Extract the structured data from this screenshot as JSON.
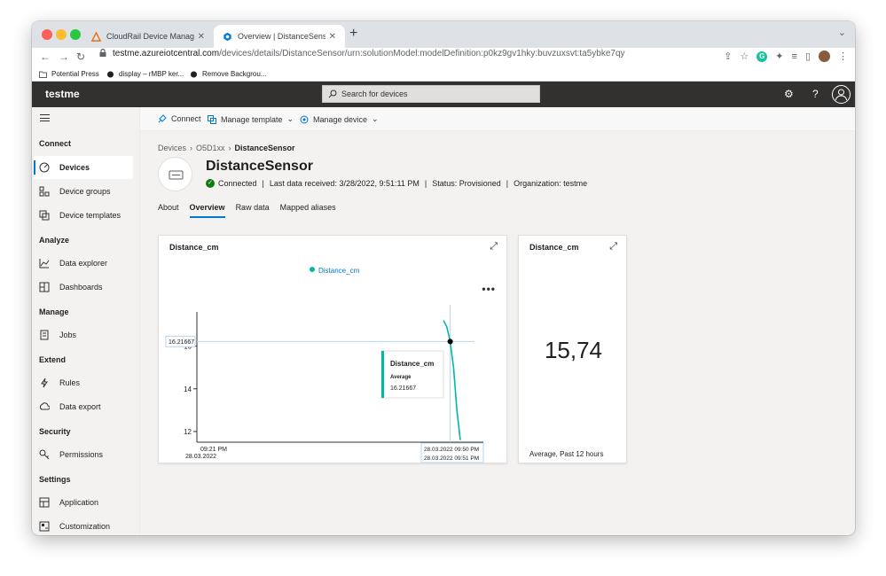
{
  "browser": {
    "tabs": [
      {
        "title": "CloudRail Device Management",
        "close": "✕"
      },
      {
        "title": "Overview | DistanceSensor, te",
        "close": "✕"
      }
    ],
    "new_tab": "+",
    "url_host": "testme.azureiotcentral.com",
    "url_path": "/devices/details/DistanceSensor/urn:solutionModel:modelDefinition:p0kz9gv1hky:buvzuxsvt:ta5ybke7qy",
    "bookmarks": [
      "Potential Press",
      "display – rMBP ker...",
      "Remove Backgrou..."
    ],
    "extension_letter": "G"
  },
  "app": {
    "name": "testme",
    "search_placeholder": "Search for devices"
  },
  "sidebar": {
    "sections": [
      {
        "title": "Connect",
        "items": [
          {
            "label": "Devices",
            "icon": "devices-icon",
            "active": true
          },
          {
            "label": "Device groups",
            "icon": "device-groups-icon"
          },
          {
            "label": "Device templates",
            "icon": "device-templates-icon"
          }
        ]
      },
      {
        "title": "Analyze",
        "items": [
          {
            "label": "Data explorer",
            "icon": "data-explorer-icon"
          },
          {
            "label": "Dashboards",
            "icon": "dashboards-icon"
          }
        ]
      },
      {
        "title": "Manage",
        "items": [
          {
            "label": "Jobs",
            "icon": "jobs-icon"
          }
        ]
      },
      {
        "title": "Extend",
        "items": [
          {
            "label": "Rules",
            "icon": "rules-icon"
          },
          {
            "label": "Data export",
            "icon": "data-export-icon"
          }
        ]
      },
      {
        "title": "Security",
        "items": [
          {
            "label": "Permissions",
            "icon": "permissions-icon"
          }
        ]
      },
      {
        "title": "Settings",
        "items": [
          {
            "label": "Application",
            "icon": "application-icon"
          },
          {
            "label": "Customization",
            "icon": "customization-icon"
          }
        ]
      }
    ]
  },
  "commands": {
    "connect": "Connect",
    "manage_template": "Manage template",
    "manage_device": "Manage device"
  },
  "breadcrumb": {
    "devices": "Devices",
    "group": "O5D1xx",
    "current": "DistanceSensor"
  },
  "device": {
    "name": "DistanceSensor",
    "connection": "Connected",
    "last_data": "Last data received: 3/28/2022, 9:51:11 PM",
    "status": "Status: Provisioned",
    "organization": "Organization: testme",
    "separator": "|"
  },
  "page_tabs": [
    {
      "label": "About",
      "selected": false
    },
    {
      "label": "Overview",
      "selected": true
    },
    {
      "label": "Raw data",
      "selected": false
    },
    {
      "label": "Mapped aliases",
      "selected": false
    }
  ],
  "chart_tile": {
    "title": "Distance_cm",
    "more": "•••",
    "tooltip": {
      "title": "Distance_cm",
      "aggregation": "Average",
      "value": "16.21667"
    },
    "crosshair_label": "16.21667",
    "x_start_time": "09:21 PM",
    "x_start_date": "28.03.2022",
    "x_range_start": "28.03.2022 09:50 PM",
    "x_range_end": "28.03.2022 09:51 PM"
  },
  "kpi_tile": {
    "title": "Distance_cm",
    "value": "15,74",
    "footer": "Average, Past 12 hours"
  },
  "colors": {
    "accent": "#0078d4",
    "series": "#00b7a8",
    "header": "#323130",
    "connected": "#107c10"
  },
  "chart_data": {
    "type": "line",
    "series": [
      {
        "name": "Distance_cm",
        "color": "#00b7a8",
        "points": [
          {
            "time": "09:50:20 PM",
            "value": 17.2
          },
          {
            "time": "09:50:35 PM",
            "value": 16.9
          },
          {
            "time": "09:50:45 PM",
            "value": 16.21667
          },
          {
            "time": "09:50:55 PM",
            "value": 15.0
          },
          {
            "time": "09:51:05 PM",
            "value": 13.0
          },
          {
            "time": "09:51:11 PM",
            "value": 11.6
          }
        ]
      }
    ],
    "y_ticks": [
      "12",
      "14",
      "16"
    ],
    "ylim": [
      11.5,
      17.6
    ],
    "legend": "top"
  }
}
